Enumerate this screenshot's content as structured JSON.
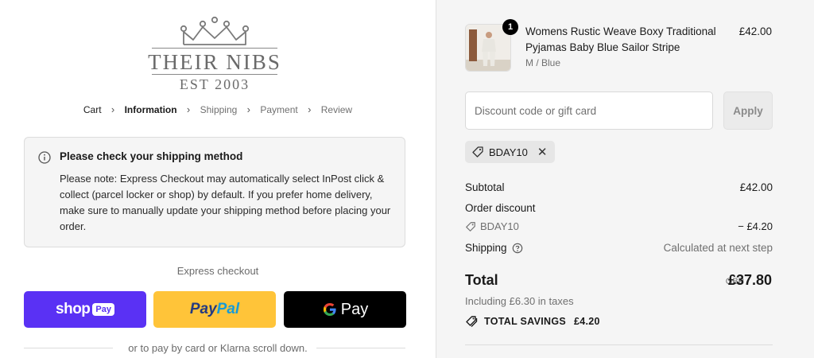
{
  "brand": {
    "name": "THEIR NIBS",
    "est": "EST 2003"
  },
  "breadcrumb": {
    "items": [
      {
        "label": "Cart",
        "state": "link"
      },
      {
        "label": "Information",
        "state": "current"
      },
      {
        "label": "Shipping",
        "state": "disabled"
      },
      {
        "label": "Payment",
        "state": "disabled"
      },
      {
        "label": "Review",
        "state": "disabled"
      }
    ]
  },
  "notice": {
    "icon": "info-icon",
    "title": "Please check your shipping method",
    "body": "Please note: Express Checkout may automatically select InPost click & collect (parcel locker or shop) by default. If you prefer home delivery, make sure to manually update your shipping method before placing your order."
  },
  "express": {
    "label": "Express checkout",
    "shop_pay": {
      "word": "shop",
      "pill": "Pay",
      "color": "#5a31f4"
    },
    "paypal": {
      "part1": "Pay",
      "part2": "Pal",
      "color": "#ffc439"
    },
    "google_pay": {
      "g": "G",
      "pay": "Pay",
      "color": "#000000"
    },
    "divider_text": "or to pay by card or Klarna scroll down."
  },
  "order": {
    "product": {
      "quantity": "1",
      "name": "Womens Rustic Weave Boxy Traditional Pyjamas Baby Blue Sailor Stripe",
      "variant": "M / Blue",
      "price": "£42.00"
    },
    "discount": {
      "placeholder": "Discount code or gift card",
      "apply_label": "Apply",
      "applied_code": "BDAY10"
    },
    "summary": {
      "subtotal_label": "Subtotal",
      "subtotal_value": "£42.00",
      "order_discount_label": "Order discount",
      "discount_code": "BDAY10",
      "discount_value": "− £4.20",
      "shipping_label": "Shipping",
      "shipping_value": "Calculated at next step",
      "total_label": "Total",
      "currency": "GBP",
      "total_value": "£37.80",
      "taxes_text": "Including £6.30 in taxes",
      "savings_label": "TOTAL SAVINGS",
      "savings_value": "£4.20"
    }
  }
}
